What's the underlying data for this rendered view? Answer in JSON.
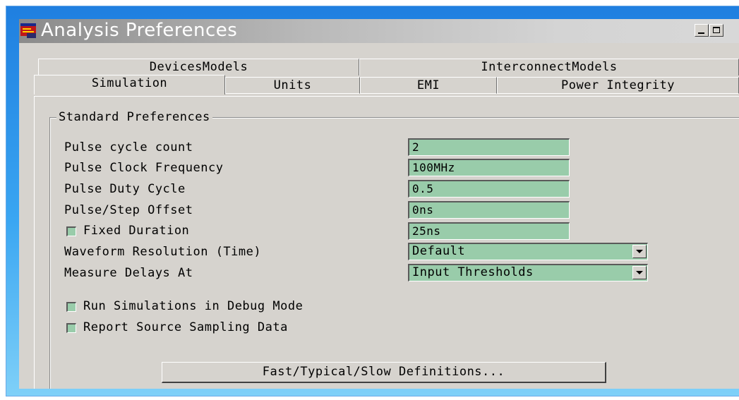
{
  "window": {
    "title": "Analysis Preferences"
  },
  "tabs": {
    "back_row": [
      "DevicesModels",
      "InterconnectModels"
    ],
    "front_row": [
      "Simulation",
      "Units",
      "EMI",
      "Power Integrity"
    ],
    "active": "Simulation"
  },
  "group": {
    "title": "Standard Preferences"
  },
  "fields": [
    {
      "label": "Pulse cycle count",
      "value": "2"
    },
    {
      "label": "Pulse Clock Frequency",
      "value": "100MHz"
    },
    {
      "label": "Pulse Duty Cycle",
      "value": "0.5"
    },
    {
      "label": "Pulse/Step Offset",
      "value": "0ns"
    }
  ],
  "fixed_duration": {
    "label": "Fixed Duration",
    "value": "25ns",
    "checked": false
  },
  "selects": [
    {
      "label": "Waveform Resolution (Time)",
      "value": "Default"
    },
    {
      "label": "Measure Delays At",
      "value": "Input Thresholds"
    }
  ],
  "checkboxes": [
    {
      "label": "Run Simulations in Debug Mode",
      "checked": false
    },
    {
      "label": "Report Source Sampling Data",
      "checked": false
    }
  ],
  "button": {
    "label": "Fast/Typical/Slow Definitions..."
  },
  "colors": {
    "field_bg": "#99ccaa",
    "window_bg": "#d6d3ce",
    "frame_blue": "#2b8fe8"
  },
  "icons": {
    "app": "app-window-icon",
    "minimize": "minimize-icon",
    "maximize": "maximize-icon",
    "dropdown": "chevron-down-icon"
  }
}
